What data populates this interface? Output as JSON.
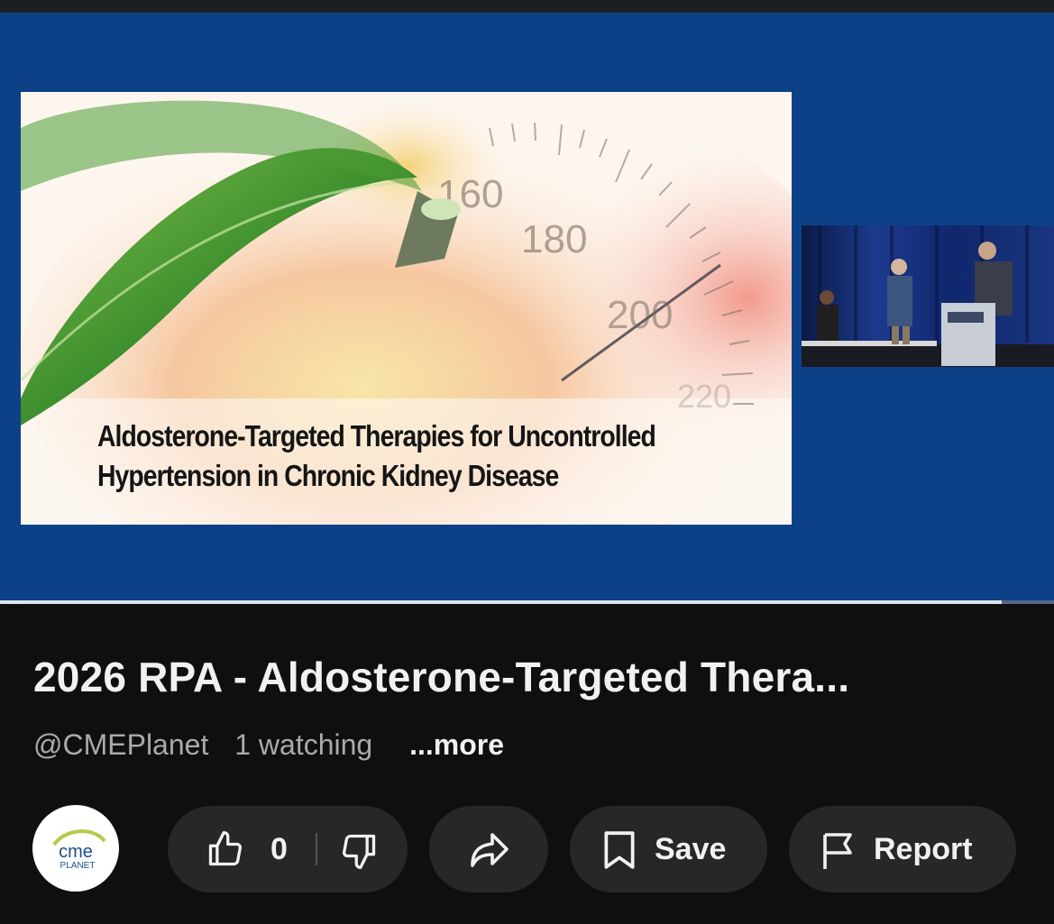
{
  "video": {
    "slide_title_line1": "Aldosterone-Targeted Therapies for Uncontrolled",
    "slide_title_line2": "Hypertension in Chronic Kidney Disease",
    "gauge_labels": [
      "160",
      "180",
      "200",
      "220"
    ],
    "progress_fraction": 0.95
  },
  "info": {
    "title": "2026 RPA - Aldosterone-Targeted Thera...",
    "channel": "@CMEPlanet",
    "watching": "1 watching",
    "more": "...more"
  },
  "channel_logo": {
    "text_main": "cme",
    "text_sub": "PLANET"
  },
  "actions": {
    "like_count": "0",
    "save_label": "Save",
    "report_label": "Report"
  },
  "icons": {
    "like": "thumbs-up-icon",
    "dislike": "thumbs-down-icon",
    "share": "share-arrow-icon",
    "save": "bookmark-icon",
    "report": "flag-icon"
  },
  "colors": {
    "player_bg": "#0d4187",
    "page_bg": "#0f0f0f",
    "pill_bg": "#272727",
    "text_primary": "#f1f1f1",
    "text_secondary": "#aaaaaa"
  }
}
